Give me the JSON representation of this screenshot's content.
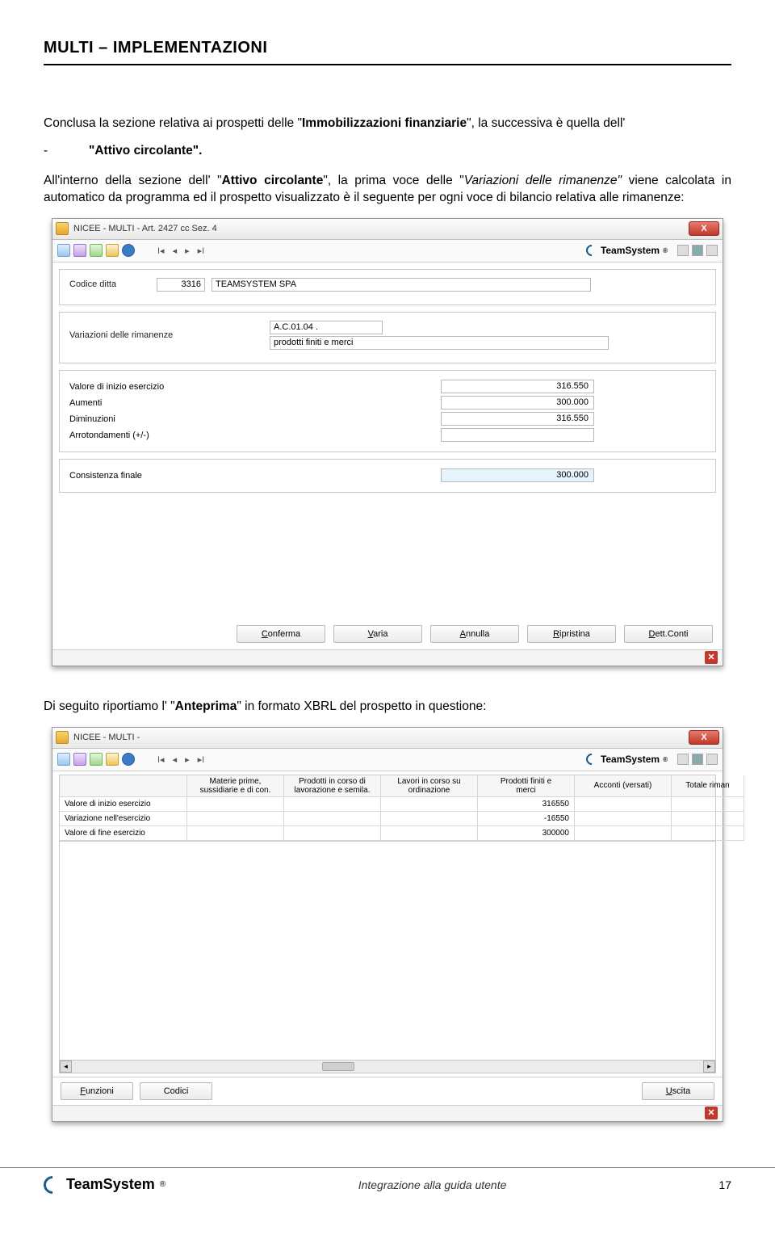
{
  "header": {
    "title": "MULTI – IMPLEMENTAZIONI"
  },
  "para1": {
    "pre": "Conclusa la sezione relativa ai prospetti delle \"",
    "bold1": "Immobilizzazioni finanziarie",
    "mid": "\", la successiva è quella dell'"
  },
  "bullet": {
    "dash": "-",
    "text": "\"Attivo circolante\"."
  },
  "para2": {
    "t1": "All'interno della sezione dell' \"",
    "b1": "Attivo circolante",
    "t2": "\", la prima voce delle \"",
    "i1": "Variazioni delle rimanenze\"",
    "t3": " viene calcolata in automatico da programma ed il prospetto visualizzato è il seguente per ogni voce di bilancio relativa alle rimanenze:"
  },
  "ss1": {
    "title": "NICEE  - MULTI - Art. 2427 cc Sez. 4",
    "close": "X",
    "brand": "TeamSystem",
    "codice_ditta_label": "Codice ditta",
    "codice_ditta_value": "3316",
    "ditta_name": "TEAMSYSTEM SPA",
    "variazioni_label": "Variazioni delle rimanenze",
    "code_value": "A.C.01.04 .",
    "code_desc": "prodotti finiti e merci",
    "rows": {
      "valore_inizio": {
        "label": "Valore di inizio esercizio",
        "value": "316.550"
      },
      "aumenti": {
        "label": "Aumenti",
        "value": "300.000"
      },
      "diminuzioni": {
        "label": "Diminuzioni",
        "value": "316.550"
      },
      "arrotondamenti": {
        "label": "Arrotondamenti (+/-)",
        "value": ""
      }
    },
    "consistenza": {
      "label": "Consistenza finale",
      "value": "300.000"
    },
    "buttons": {
      "conferma": "Conferma",
      "varia": "Varia",
      "annulla": "Annulla",
      "ripristina": "Ripristina",
      "dettconti": "Dett.Conti"
    }
  },
  "para3": {
    "t1": "Di seguito riportiamo l' \"",
    "b1": "Anteprima",
    "t2": "\" in formato XBRL del prospetto in questione:"
  },
  "ss2": {
    "title": "NICEE  - MULTI -",
    "close": "X",
    "brand": "TeamSystem",
    "headers": {
      "c1a": "Materie prime,",
      "c1b": "sussidiarie e di con.",
      "c2a": "Prodotti in corso di",
      "c2b": "lavorazione e semila.",
      "c3a": "Lavori in corso su",
      "c3b": "ordinazione",
      "c4a": "Prodotti finiti e",
      "c4b": "merci",
      "c5a": "Acconti (versati)",
      "c5b": "",
      "c6a": "Totale riman",
      "c6b": ""
    },
    "rows": {
      "r1": {
        "label": "Valore di inizio esercizio",
        "c4": "316550"
      },
      "r2": {
        "label": "Variazione nell'esercizio",
        "c4": "-16550"
      },
      "r3": {
        "label": "Valore di fine esercizio",
        "c4": "300000"
      }
    },
    "buttons": {
      "funzioni": "Funzioni",
      "codici": "Codici",
      "uscita": "Uscita"
    }
  },
  "footer": {
    "brand": "TeamSystem",
    "center": "Integrazione alla guida utente",
    "page": "17"
  }
}
